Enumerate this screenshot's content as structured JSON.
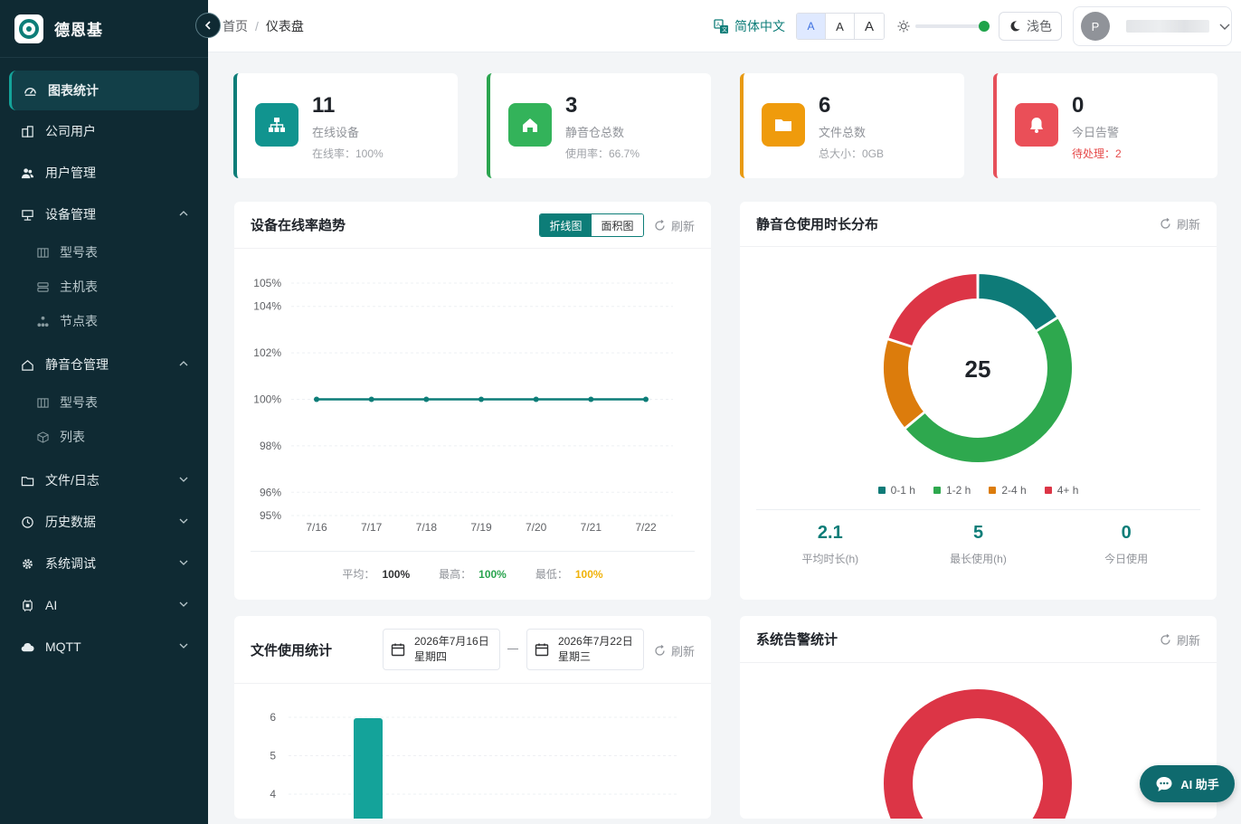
{
  "brand": {
    "name": "德恩基"
  },
  "sidebar": {
    "items": [
      {
        "label": "图表统计",
        "icon": "dashboard-icon"
      },
      {
        "label": "公司用户",
        "icon": "building-icon"
      },
      {
        "label": "用户管理",
        "icon": "users-icon"
      },
      {
        "label": "设备管理",
        "icon": "device-icon"
      },
      {
        "label": "静音仓管理",
        "icon": "home-icon"
      },
      {
        "label": "文件/日志",
        "icon": "folder-icon"
      },
      {
        "label": "历史数据",
        "icon": "history-icon"
      },
      {
        "label": "系统调试",
        "icon": "gear-icon"
      },
      {
        "label": "AI",
        "icon": "ai-icon"
      },
      {
        "label": "MQTT",
        "icon": "cloud-icon"
      }
    ],
    "device_sub": [
      {
        "label": "型号表",
        "icon": "table-icon"
      },
      {
        "label": "主机表",
        "icon": "server-icon"
      },
      {
        "label": "节点表",
        "icon": "nodes-icon"
      }
    ],
    "cabin_sub": [
      {
        "label": "型号表",
        "icon": "table-icon"
      },
      {
        "label": "列表",
        "icon": "cube-icon"
      }
    ]
  },
  "header": {
    "breadcrumb": [
      "首页",
      "仪表盘"
    ],
    "language": "简体中文",
    "font_sizes": [
      "A",
      "A",
      "A"
    ],
    "theme": "浅色",
    "avatar": "P"
  },
  "stats": [
    {
      "value": "11",
      "label": "在线设备",
      "sub": "在线率：100%",
      "color": "#0d7d78",
      "icon": "network-icon"
    },
    {
      "value": "3",
      "label": "静音仓总数",
      "sub": "使用率：66.7%",
      "color": "#2aa44f",
      "icon": "house-icon"
    },
    {
      "value": "6",
      "label": "文件总数",
      "sub": "总大小：0GB",
      "color": "#e89a12",
      "icon": "folder-icon"
    },
    {
      "value": "0",
      "label": "今日告警",
      "sub": "待处理：2",
      "color": "#e6505a",
      "icon": "bell-icon"
    }
  ],
  "trend": {
    "title": "设备在线率趋势",
    "toggle": [
      "折线图",
      "面积图"
    ],
    "refresh": "刷新",
    "footer": {
      "avg_label": "平均：",
      "avg": "100%",
      "max_label": "最高：",
      "max": "100%",
      "min_label": "最低：",
      "min": "100%"
    }
  },
  "usage": {
    "title": "静音仓使用时长分布",
    "refresh": "刷新",
    "center": "25",
    "stats": [
      {
        "value": "2.1",
        "label": "平均时长(h)"
      },
      {
        "value": "5",
        "label": "最长使用(h)"
      },
      {
        "value": "0",
        "label": "今日使用"
      }
    ]
  },
  "files": {
    "title": "文件使用统计",
    "refresh": "刷新",
    "start_date": "2026年7月16日",
    "start_day": "星期四",
    "end_date": "2026年7月22日",
    "end_day": "星期三"
  },
  "alarms": {
    "title": "系统告警统计",
    "refresh": "刷新"
  },
  "ai_button": "AI 助手",
  "chart_data": [
    {
      "type": "line",
      "x": [
        "7/16",
        "7/17",
        "7/18",
        "7/19",
        "7/20",
        "7/21",
        "7/22"
      ],
      "series": [
        {
          "values": [
            100,
            100,
            100,
            100,
            100,
            100,
            100
          ],
          "color": "#0d7d78"
        }
      ],
      "y_ticks": [
        "105%",
        "104%",
        "102%",
        "100%",
        "98%",
        "96%",
        "95%"
      ],
      "ylim": [
        95,
        105
      ],
      "grid": true
    },
    {
      "type": "pie",
      "categories": [
        "0-1 h",
        "1-2 h",
        "2-4 h",
        "4+ h"
      ],
      "values": [
        4,
        12,
        4,
        5
      ],
      "colors": [
        "#0e7b78",
        "#2ea84e",
        "#dc7c0c",
        "#dc3546"
      ],
      "legend": "bottom"
    },
    {
      "type": "bar",
      "y_ticks": [
        "6",
        "5",
        "4"
      ],
      "values": [
        6
      ],
      "color": "#14a39a",
      "grid": true
    },
    {
      "type": "pie",
      "values": [
        1
      ],
      "colors": [
        "#dc3546"
      ]
    }
  ]
}
